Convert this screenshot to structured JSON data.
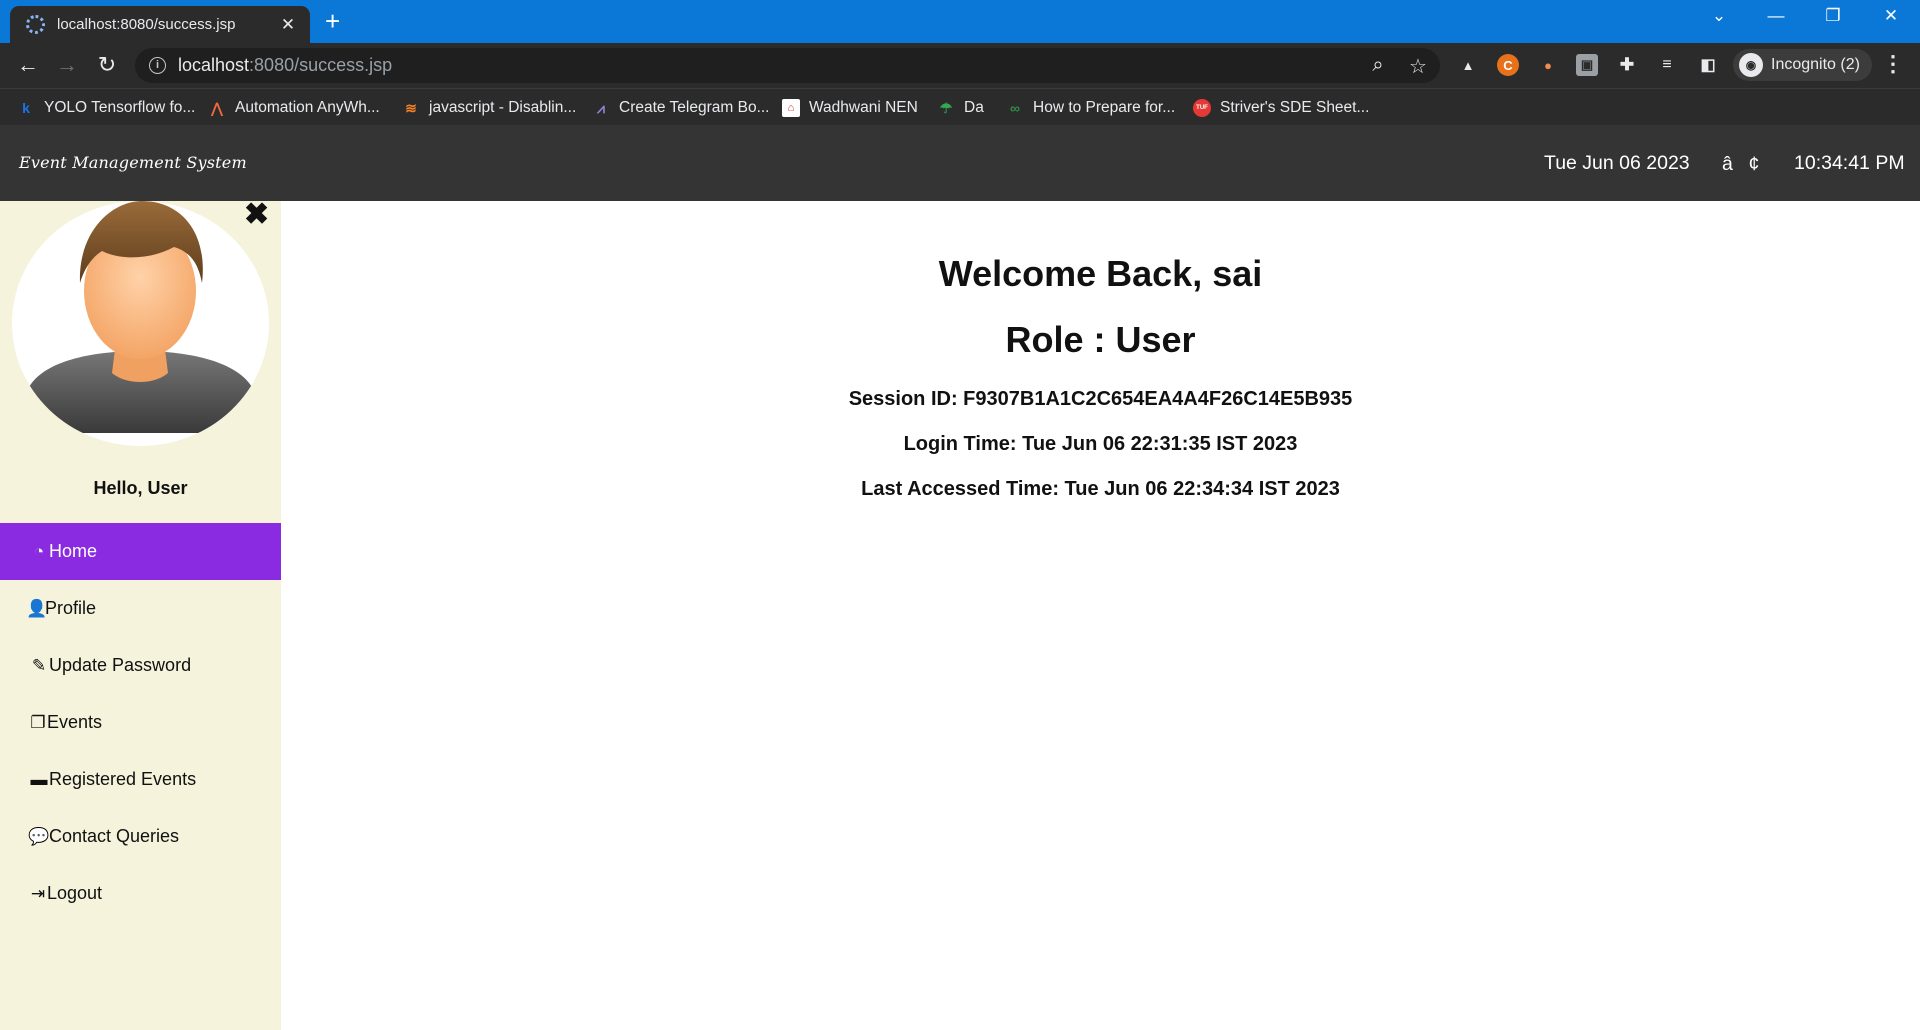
{
  "browser": {
    "tab_title": "localhost:8080/success.jsp",
    "url_host": "localhost",
    "url_rest": ":8080/success.jsp",
    "incognito_label": "Incognito (2)",
    "bookmarks": [
      {
        "label": "YOLO Tensorflow fo...",
        "icon": "k"
      },
      {
        "label": "Automation AnyWh...",
        "icon": "A"
      },
      {
        "label": "javascript - Disablin...",
        "icon": "so"
      },
      {
        "label": "Create Telegram Bo...",
        "icon": "dev"
      },
      {
        "label": "Wadhwani NEN",
        "icon": "nen"
      },
      {
        "label": "Da",
        "icon": "umbrella"
      },
      {
        "label": "How to Prepare for...",
        "icon": "gfg"
      },
      {
        "label": "Striver's SDE Sheet...",
        "icon": "TUF"
      }
    ]
  },
  "header": {
    "brand": "Event Management System",
    "date": "Tue Jun 06 2023",
    "separator": "â¢",
    "time": "10:34:41 PM"
  },
  "sidebar": {
    "greeting": "Hello, User",
    "items": [
      {
        "label": "Home",
        "icon": "dashboard-icon",
        "active": true
      },
      {
        "label": "Profile",
        "icon": "user-icon",
        "active": false
      },
      {
        "label": "Update Password",
        "icon": "edit-icon",
        "active": false
      },
      {
        "label": "Events",
        "icon": "copy-icon",
        "active": false
      },
      {
        "label": "Registered Events",
        "icon": "credit-card-icon",
        "active": false
      },
      {
        "label": "Contact Queries",
        "icon": "comments-icon",
        "active": false
      },
      {
        "label": "Logout",
        "icon": "logout-icon",
        "active": false
      }
    ]
  },
  "main": {
    "welcome": "Welcome Back, sai",
    "role": "Role : User",
    "session": "Session ID: F9307B1A1C2C654EA4A4F26C14E5B935",
    "login_time": "Login Time: Tue Jun 06 22:31:35 IST 2023",
    "last_accessed": "Last Accessed Time: Tue Jun 06 22:34:34 IST 2023"
  },
  "colors": {
    "tabbar": "#0b78d7",
    "chrome": "#2b2b2b",
    "header": "#343434",
    "sidebar": "#f5f3dc",
    "active_nav": "#8a2be2"
  }
}
